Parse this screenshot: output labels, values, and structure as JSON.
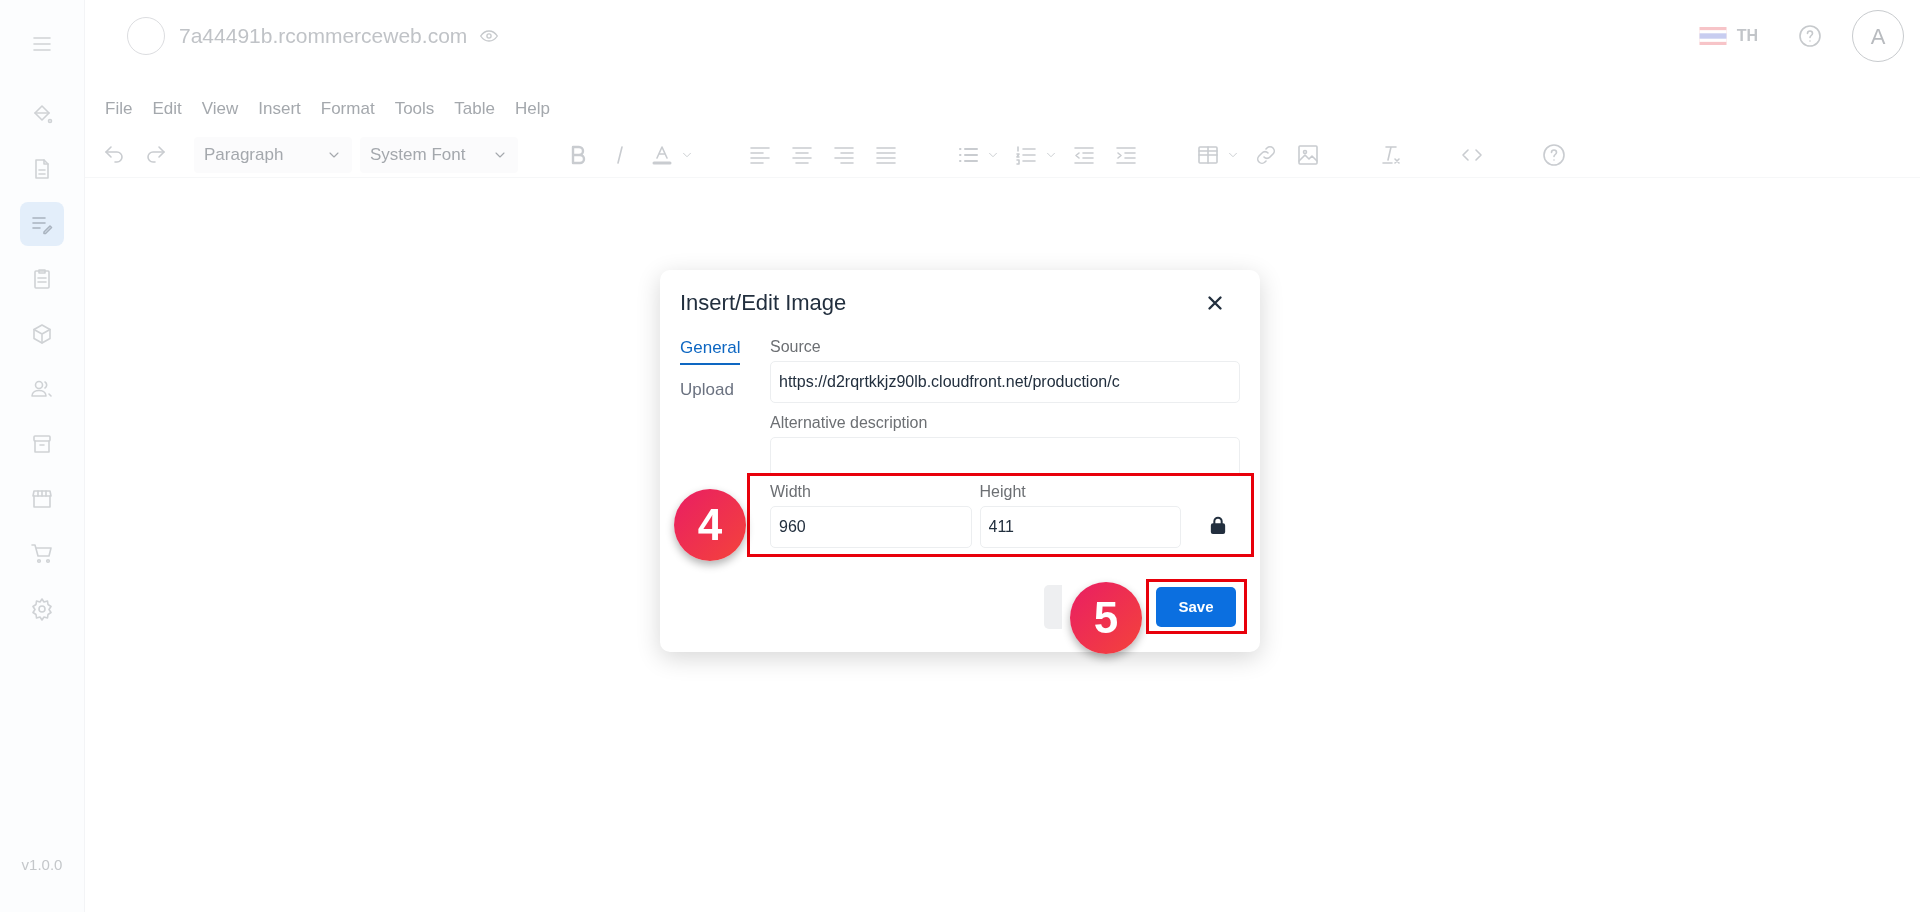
{
  "header": {
    "site": "7a44491b.rcommerceweb.com",
    "language": "TH",
    "avatar": "A"
  },
  "sidebar": {
    "items": [
      {
        "selected": false
      },
      {
        "selected": false
      },
      {
        "selected": true
      },
      {
        "selected": false
      },
      {
        "selected": false
      },
      {
        "selected": false
      },
      {
        "selected": false
      },
      {
        "selected": false
      },
      {
        "selected": false
      },
      {
        "selected": false
      }
    ],
    "version": "v1.0.0"
  },
  "menubar": [
    "File",
    "Edit",
    "View",
    "Insert",
    "Format",
    "Tools",
    "Table",
    "Help"
  ],
  "toolbar": {
    "block_format": "Paragraph",
    "font": "System Font"
  },
  "dialog": {
    "title": "Insert/Edit Image",
    "tabs": [
      {
        "label": "General",
        "selected": true
      },
      {
        "label": "Upload",
        "selected": false
      }
    ],
    "source": {
      "label": "Source",
      "value": "https://d2rqrtkkjz90lb.cloudfront.net/production/c"
    },
    "alt": {
      "label": "Alternative description"
    },
    "width": {
      "label": "Width",
      "value": "960"
    },
    "height": {
      "label": "Height",
      "value": "411"
    },
    "constrain_proportions": true,
    "dimensions": {
      "highlighted": true,
      "step": "4"
    },
    "save": {
      "label": "Save",
      "highlighted": true,
      "step": "5"
    }
  }
}
